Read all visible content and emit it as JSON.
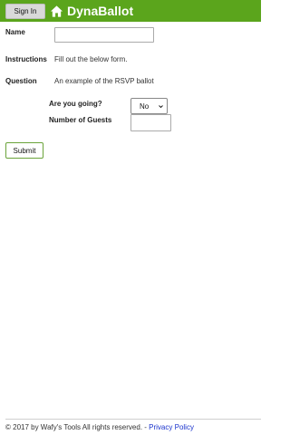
{
  "header": {
    "signin_label": "Sign In",
    "brand": "DynaBallot",
    "home_icon": "home-icon",
    "bg_color": "#5ba51c"
  },
  "form": {
    "name_label": "Name",
    "name_value": "",
    "instructions_label": "Instructions",
    "instructions_text": "Fill out the below form.",
    "question_label": "Question",
    "question_text": "An example of the RSVP ballot",
    "going_label": "Are you going?",
    "going_value": "No",
    "guests_label": "Number of Guests",
    "guests_value": "",
    "submit_label": "Submit"
  },
  "footer": {
    "copyright": "© 2017 by Wafy's Tools All rights reserved. - ",
    "privacy_label": "Privacy Policy"
  }
}
